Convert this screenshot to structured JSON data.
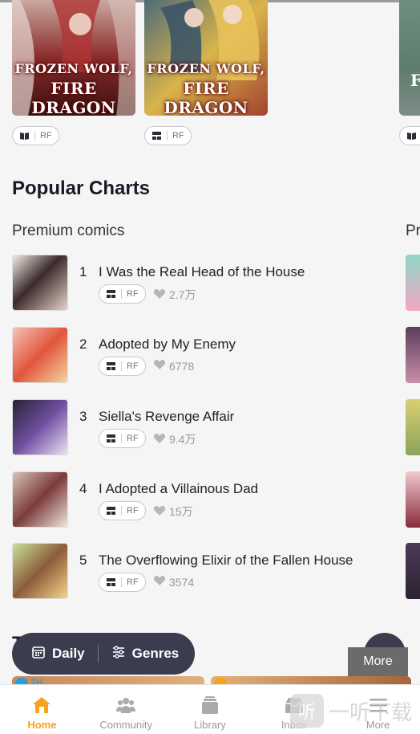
{
  "covers": [
    {
      "line1": "FROZEN WOLF,",
      "line2": "FIRE DRAGON",
      "tag": "RF",
      "tag_icon": "book-icon"
    },
    {
      "line1": "FROZEN WOLF,",
      "line2": "FIRE DRAGON",
      "tag": "RF",
      "tag_icon": "grid-icon"
    }
  ],
  "cover_edge": {
    "letter": "F"
  },
  "section_title": "Popular Charts",
  "subsection": "Premium comics",
  "subsection_next": "Pr",
  "charts": [
    {
      "rank": "1",
      "title": "I Was the Real Head of the House",
      "tag": "RF",
      "likes": "2.7万"
    },
    {
      "rank": "2",
      "title": "Adopted by My Enemy",
      "tag": "RF",
      "likes": "6778"
    },
    {
      "rank": "3",
      "title": "Siella's Revenge Affair",
      "tag": "RF",
      "likes": "9.4万"
    },
    {
      "rank": "4",
      "title": "I Adopted a Villainous Dad",
      "tag": "RF",
      "likes": "15万"
    },
    {
      "rank": "5",
      "title": "The Overflowing Elixir of the Fallen House",
      "tag": "RF",
      "likes": "3574"
    }
  ],
  "filter": {
    "daily": "Daily",
    "genres": "Genres"
  },
  "behind_heading_letter": "T",
  "peek_badge": "2H",
  "more_tooltip": "More",
  "nav": [
    {
      "label": "Home",
      "icon": "home-icon"
    },
    {
      "label": "Community",
      "icon": "community-icon"
    },
    {
      "label": "Library",
      "icon": "library-icon"
    },
    {
      "label": "Inbox",
      "icon": "inbox-icon"
    },
    {
      "label": "More",
      "icon": "menu-icon"
    }
  ],
  "watermark": {
    "logo": "听",
    "text": "一听下载"
  },
  "colors": {
    "accent": "#f5a31a",
    "dark": "#3b3d4f",
    "bg": "#f5f5f5"
  }
}
